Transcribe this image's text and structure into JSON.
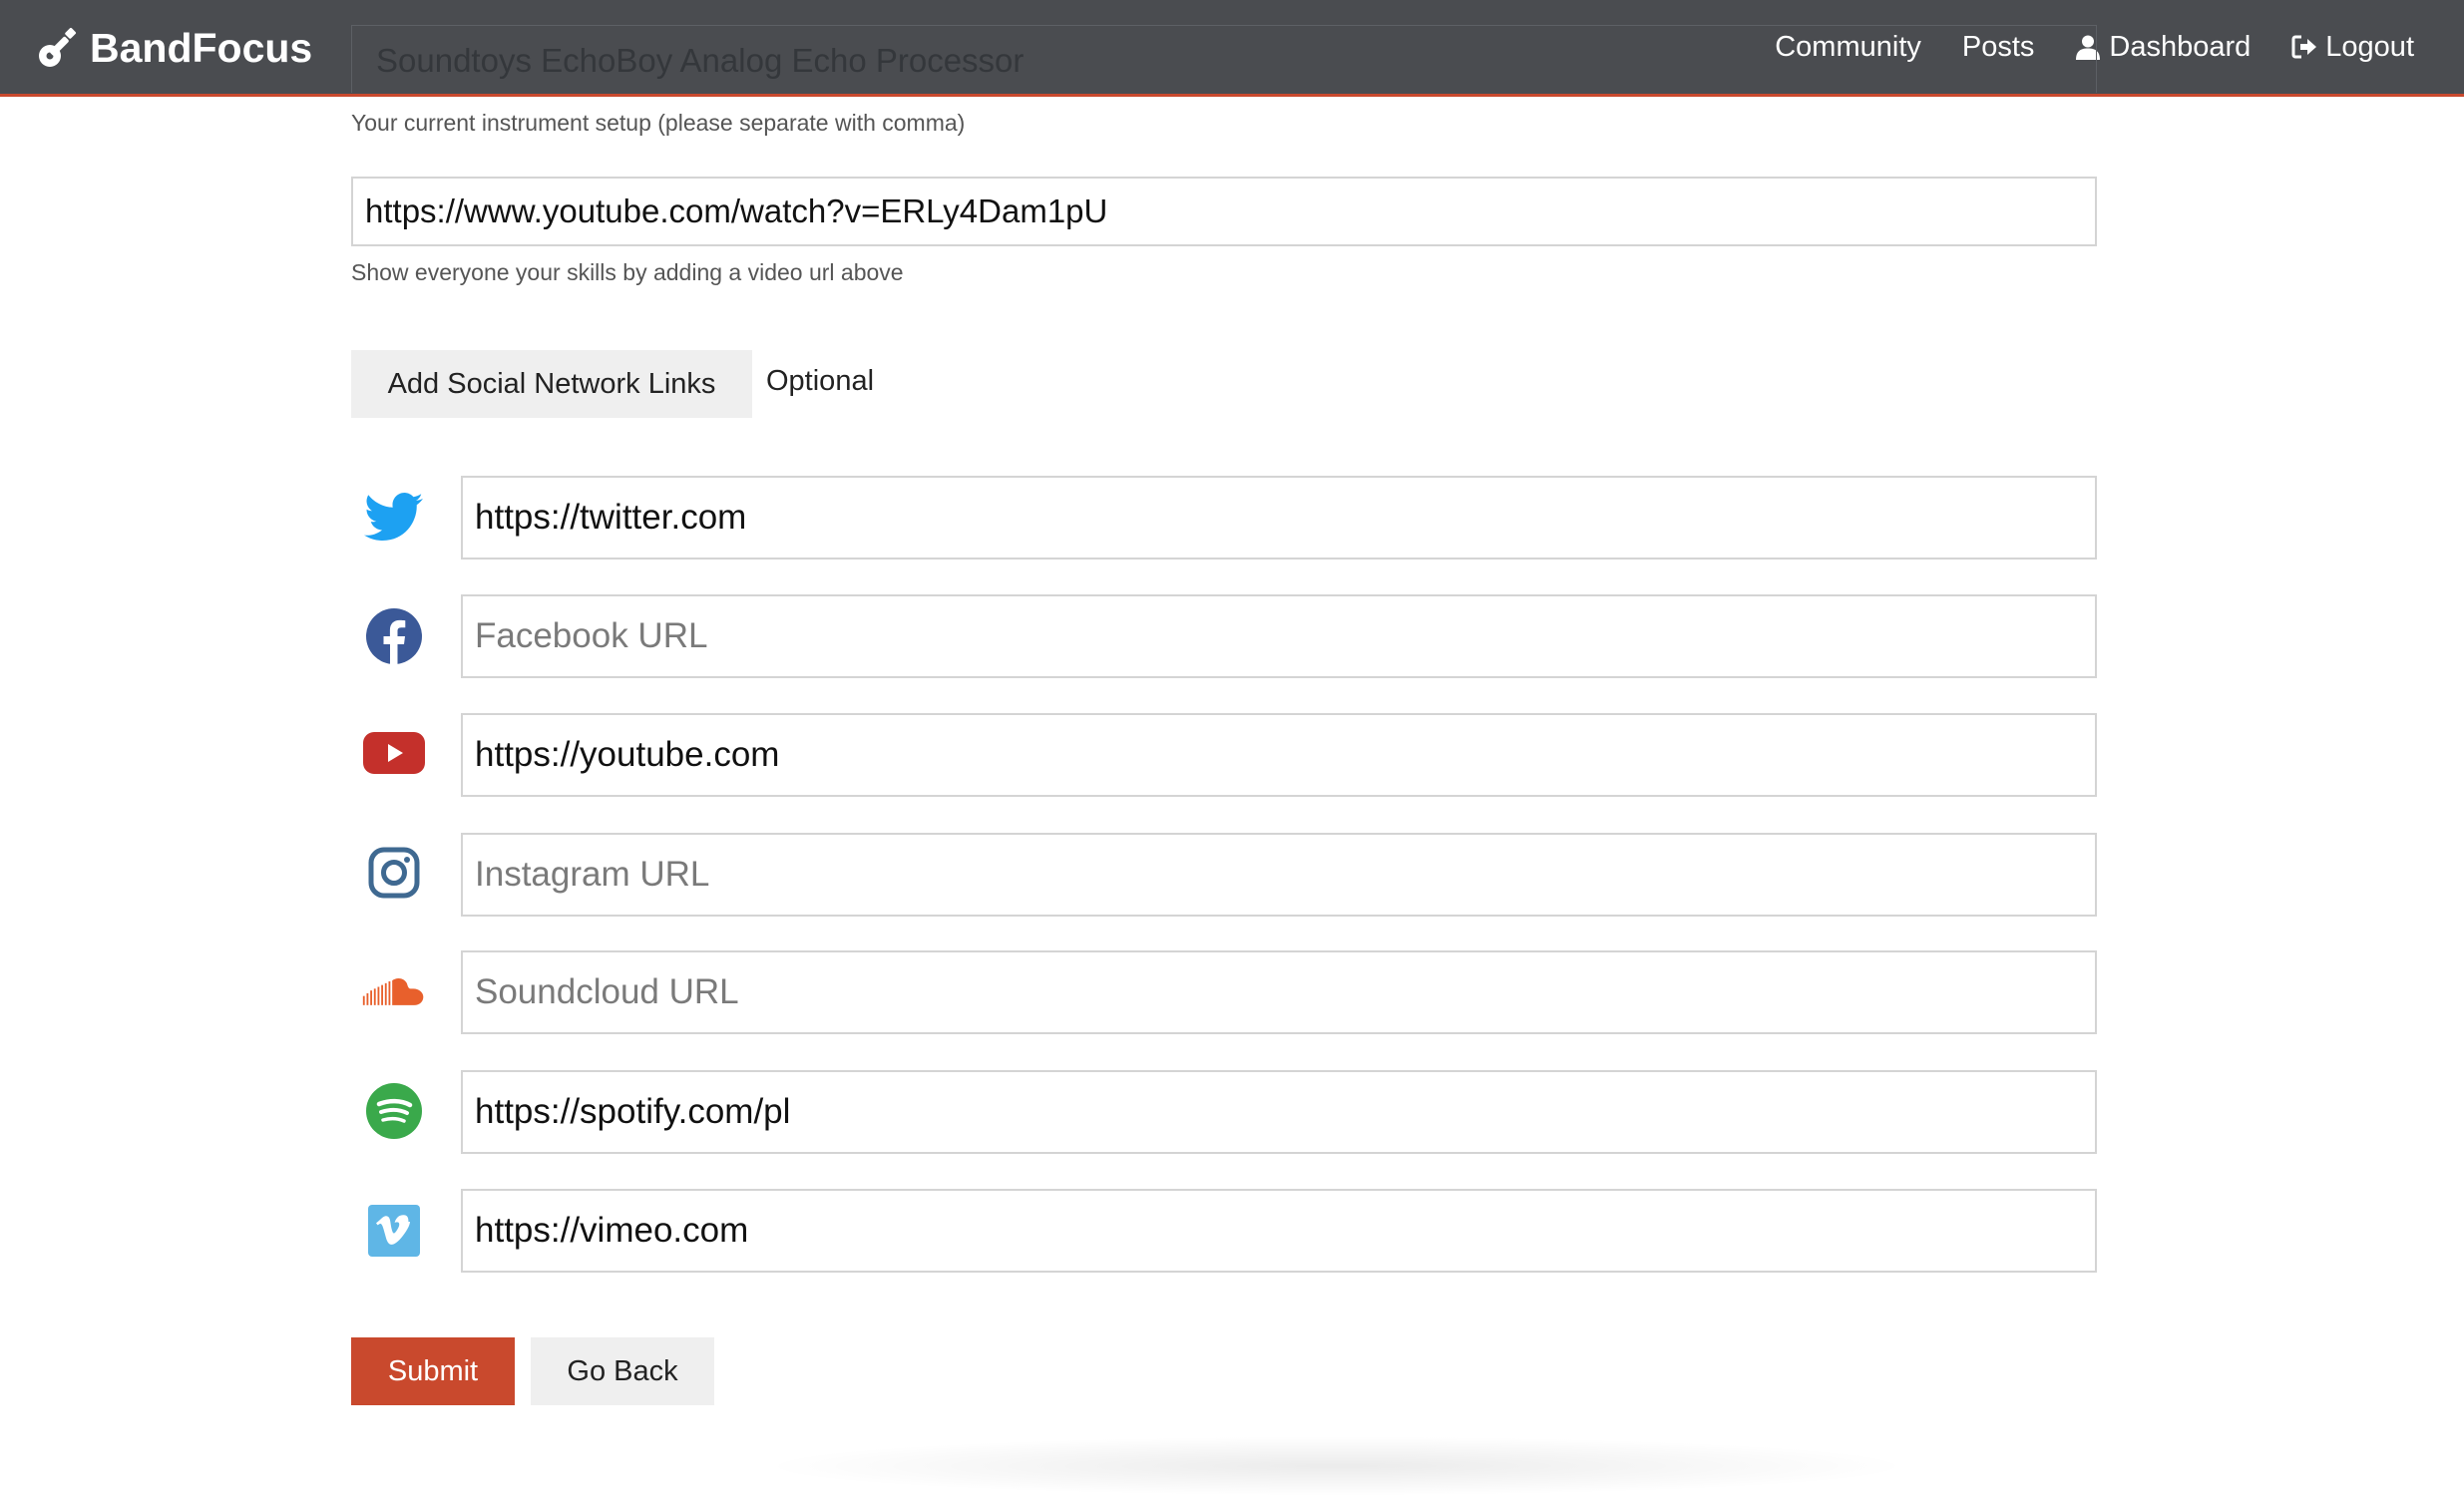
{
  "header": {
    "brand": "BandFocus",
    "nav": [
      {
        "label": "Community"
      },
      {
        "label": "Posts"
      },
      {
        "label": "Dashboard"
      },
      {
        "label": "Logout"
      }
    ]
  },
  "form": {
    "instrument_value": "Soundtoys EchoBoy Analog Echo Processor",
    "instrument_help": "Your current instrument setup (please separate with comma)",
    "video_url": "https://www.youtube.com/watch?v=ERLy4Dam1pU",
    "video_help": "Show everyone your skills by adding a video url above",
    "social_button": "Add Social Network Links",
    "optional_label": "Optional",
    "social": {
      "twitter": {
        "value": "https://twitter.com",
        "placeholder": "",
        "icon": "twitter-icon",
        "color": "#1da1f2"
      },
      "facebook": {
        "value": "",
        "placeholder": "Facebook URL",
        "icon": "facebook-icon",
        "color": "#3b5998"
      },
      "youtube": {
        "value": "https://youtube.com",
        "placeholder": "",
        "icon": "youtube-icon",
        "color": "#c4302b"
      },
      "instagram": {
        "value": "",
        "placeholder": "Instagram URL",
        "icon": "instagram-icon",
        "color": "#3f6991"
      },
      "soundcloud": {
        "value": "",
        "placeholder": "Soundcloud URL",
        "icon": "soundcloud-icon",
        "color": "#ff5500"
      },
      "spotify": {
        "value": "https://spotify.com/pl",
        "placeholder": "",
        "icon": "spotify-icon",
        "color": "#3aa94b"
      },
      "vimeo": {
        "value": "https://vimeo.com",
        "placeholder": "",
        "icon": "vimeo-icon",
        "color": "#5fb6e6"
      }
    },
    "submit": "Submit",
    "back": "Go Back"
  },
  "colors": {
    "nav_bg": "#4a4c50",
    "accent": "#c9492d"
  }
}
